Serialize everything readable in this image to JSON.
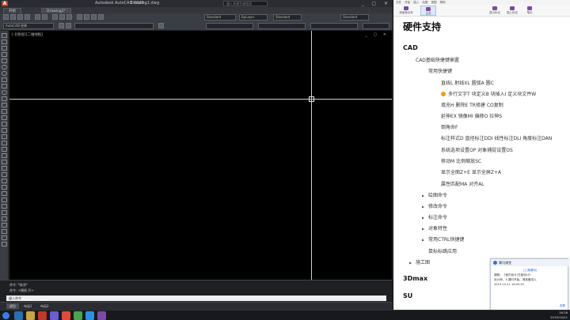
{
  "cad": {
    "title": "Autodesk AutoCAD 2020",
    "file": "Drawing1.dwg",
    "search_placeholder": "键入关键字或短语",
    "tabs": [
      "开始",
      "Drawing1*"
    ],
    "workspace": "AutoCAD 经典",
    "dropdown_std1": "Standard",
    "dropdown_layer": "ByLayer",
    "dropdown_std2": "Standard",
    "dropdown_std3": "Standard",
    "viewport_label": "[-][俯视][二维线框]",
    "cmd_history": [
      "命令: *取消*",
      "命令: <栅格 开>"
    ],
    "cmd_placeholder": "键入命令",
    "layout_tabs": [
      "模型",
      "布局1",
      "布局2"
    ],
    "search_icon": "search-icon"
  },
  "note": {
    "menu": [
      "文件",
      "开始",
      "插入",
      "绘图",
      "视图",
      "帮助"
    ],
    "ribbon": [
      "添加笔记本",
      "主页",
      "显示标记",
      "插入标记",
      "笔记"
    ],
    "page_title": "硬件支持",
    "outline": [
      {
        "text": "CAD",
        "level": 0,
        "type": "h"
      },
      {
        "text": "CAD基础快捷键章握",
        "level": 1
      },
      {
        "text": "常用快捷键",
        "level": 2
      },
      {
        "text": "直线L  射线XL  圆弧A  圆C",
        "level": 3
      },
      {
        "text": "多行文字T  块定义B  块插入I  定义块文件W",
        "level": 3,
        "dot": true
      },
      {
        "text": "填充H  删除E  TR修建  CO复制",
        "level": 3
      },
      {
        "text": "延伸EX 镜像MI 偏移O 拉伸S",
        "level": 3
      },
      {
        "text": "倒角命F",
        "level": 3
      },
      {
        "text": "标注样式D 直径标注DDI 线性标注DLI 角度标注DAN",
        "level": 3
      },
      {
        "text": "系统选项设置OP 对象捕捉设置OS",
        "level": 3
      },
      {
        "text": "移动M 比例缩放SC",
        "level": 3
      },
      {
        "text": "显示全图Z+E  显示全屏Z+A",
        "level": 3
      },
      {
        "text": "属性匹配MA 对齐AL",
        "level": 3
      },
      {
        "text": "绘图命令",
        "level": 2,
        "arrow": true
      },
      {
        "text": "修改命令",
        "level": 2,
        "arrow": true
      },
      {
        "text": "标注命令",
        "level": 2,
        "arrow": true
      },
      {
        "text": "对象特性",
        "level": 2,
        "arrow": true
      },
      {
        "text": "常用CTRL快捷键",
        "level": 2,
        "arrow": true
      },
      {
        "text": "鼠标标跳应用",
        "level": 2
      },
      {
        "text": "施工图",
        "level": 1,
        "arrow": true
      },
      {
        "text": "3Dmax",
        "level": 0,
        "type": "h"
      },
      {
        "text": "SU",
        "level": 0,
        "type": "h"
      }
    ]
  },
  "toast": {
    "header": "腾讯课堂",
    "tag": "[上课通知]",
    "line1": "课程：《室内设计/方案设计》",
    "line2": "设计师，3 课时开始，请准备进入",
    "date": "2019-10-21 16:05:01",
    "action": "查看"
  },
  "taskbar": {
    "time": "16:26",
    "date": "2019/10/21"
  }
}
